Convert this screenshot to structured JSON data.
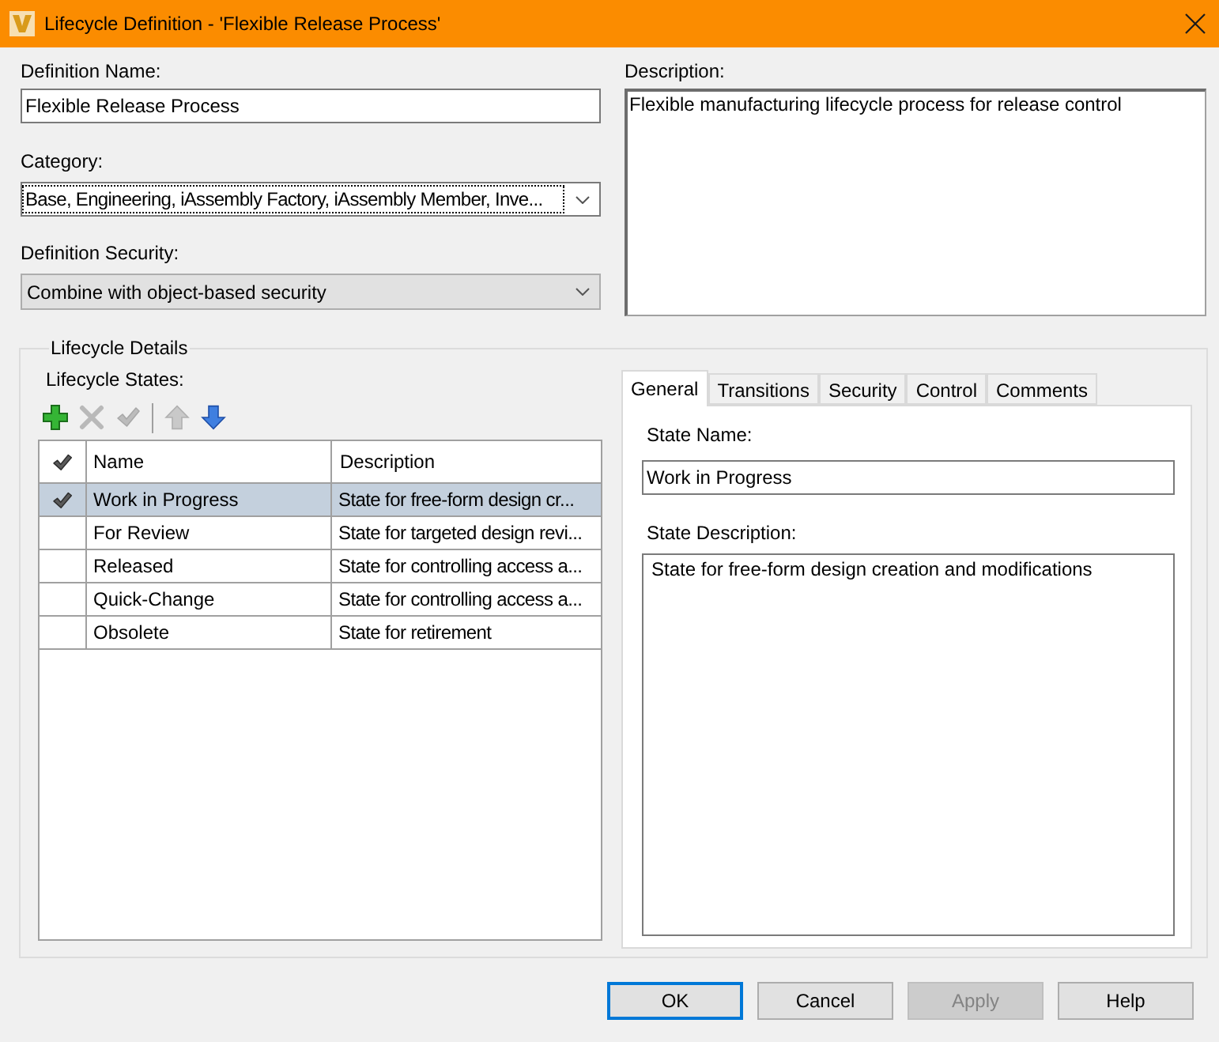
{
  "window": {
    "title": "Lifecycle Definition - 'Flexible Release Process'"
  },
  "definition_name": {
    "label": "Definition Name:",
    "value": "Flexible Release Process"
  },
  "category": {
    "label": "Category:",
    "value": "Base, Engineering, iAssembly Factory, iAssembly Member, Inve...",
    "focused": true
  },
  "definition_security": {
    "label": "Definition Security:",
    "value": "Combine with object-based security"
  },
  "description": {
    "label": "Description:",
    "value": "Flexible manufacturing lifecycle process for release control"
  },
  "lifecycle_details": {
    "title": "Lifecycle Details",
    "states_label": "Lifecycle States:",
    "toolbar_groups": [
      {
        "buttons": [
          {
            "kind": "add",
            "disabled": false
          },
          {
            "kind": "delete",
            "disabled": true
          },
          {
            "kind": "set_default",
            "disabled": true
          }
        ]
      },
      {
        "buttons": [
          {
            "kind": "move_up",
            "disabled": true
          },
          {
            "kind": "move_down",
            "disabled": false
          }
        ]
      }
    ],
    "table": {
      "columns": [
        "Name",
        "Description"
      ],
      "rows": [
        {
          "default": true,
          "name": "Work in Progress",
          "description": "State for free-form design cr...",
          "selected": true
        },
        {
          "default": false,
          "name": "For Review",
          "description": "State for targeted design revi...",
          "selected": false
        },
        {
          "default": false,
          "name": "Released",
          "description": "State for controlling access a...",
          "selected": false
        },
        {
          "default": false,
          "name": "Quick-Change",
          "description": "State for controlling access a...",
          "selected": false
        },
        {
          "default": false,
          "name": "Obsolete",
          "description": "State for retirement",
          "selected": false
        }
      ]
    },
    "tabs": [
      {
        "label": "General",
        "selected": true
      },
      {
        "label": "Transitions",
        "selected": false
      },
      {
        "label": "Security",
        "selected": false
      },
      {
        "label": "Control",
        "selected": false
      },
      {
        "label": "Comments",
        "selected": false
      }
    ],
    "state_name": {
      "label": "State Name:",
      "value": "Work in Progress"
    },
    "state_description": {
      "label": "State Description:",
      "value": "State for free-form design creation and modifications"
    }
  },
  "buttons": [
    {
      "label": "OK",
      "default": true,
      "disabled": false
    },
    {
      "label": "Cancel",
      "default": false,
      "disabled": false
    },
    {
      "label": "Apply",
      "default": false,
      "disabled": true
    },
    {
      "label": "Help",
      "default": false,
      "disabled": false
    }
  ]
}
